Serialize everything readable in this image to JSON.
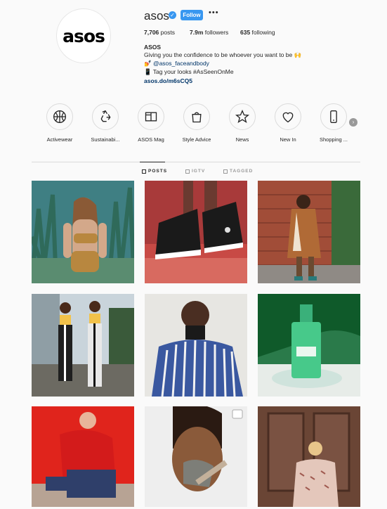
{
  "profile": {
    "avatar_text": "asos",
    "username": "asos",
    "verified_icon": "verified-badge-icon",
    "follow_label": "Follow",
    "more_label": "•••",
    "posts_count": "7,706",
    "posts_label": " posts",
    "followers_count": "7.9m",
    "followers_label": " followers",
    "following_count": "635",
    "following_label": " following",
    "name": "ASOS",
    "bio_line1": "Giving you the confidence to be whoever you want to be 🙌",
    "bio_line2": "💅 @asos_faceandbody",
    "bio_line3": "📱 Tag your looks #AsSeenOnMe",
    "link": "asos.do/m6sCQ5"
  },
  "highlights": [
    {
      "label": "Activewear",
      "icon": "basketball-icon"
    },
    {
      "label": "Sustainabi...",
      "icon": "recycle-icon"
    },
    {
      "label": "ASOS Mag",
      "icon": "magazine-icon"
    },
    {
      "label": "Style Advice",
      "icon": "shopping-bag-icon"
    },
    {
      "label": "News",
      "icon": "star-icon"
    },
    {
      "label": "New In",
      "icon": "heart-icon"
    },
    {
      "label": "Shopping ...",
      "icon": "phone-icon"
    }
  ],
  "tabs": [
    {
      "label": "POSTS",
      "active": true
    },
    {
      "label": "IGTV",
      "active": false
    },
    {
      "label": "TAGGED",
      "active": false
    }
  ],
  "colors": {
    "accent": "#3897f0",
    "link": "#003569",
    "text": "#262626",
    "muted": "#999999"
  }
}
